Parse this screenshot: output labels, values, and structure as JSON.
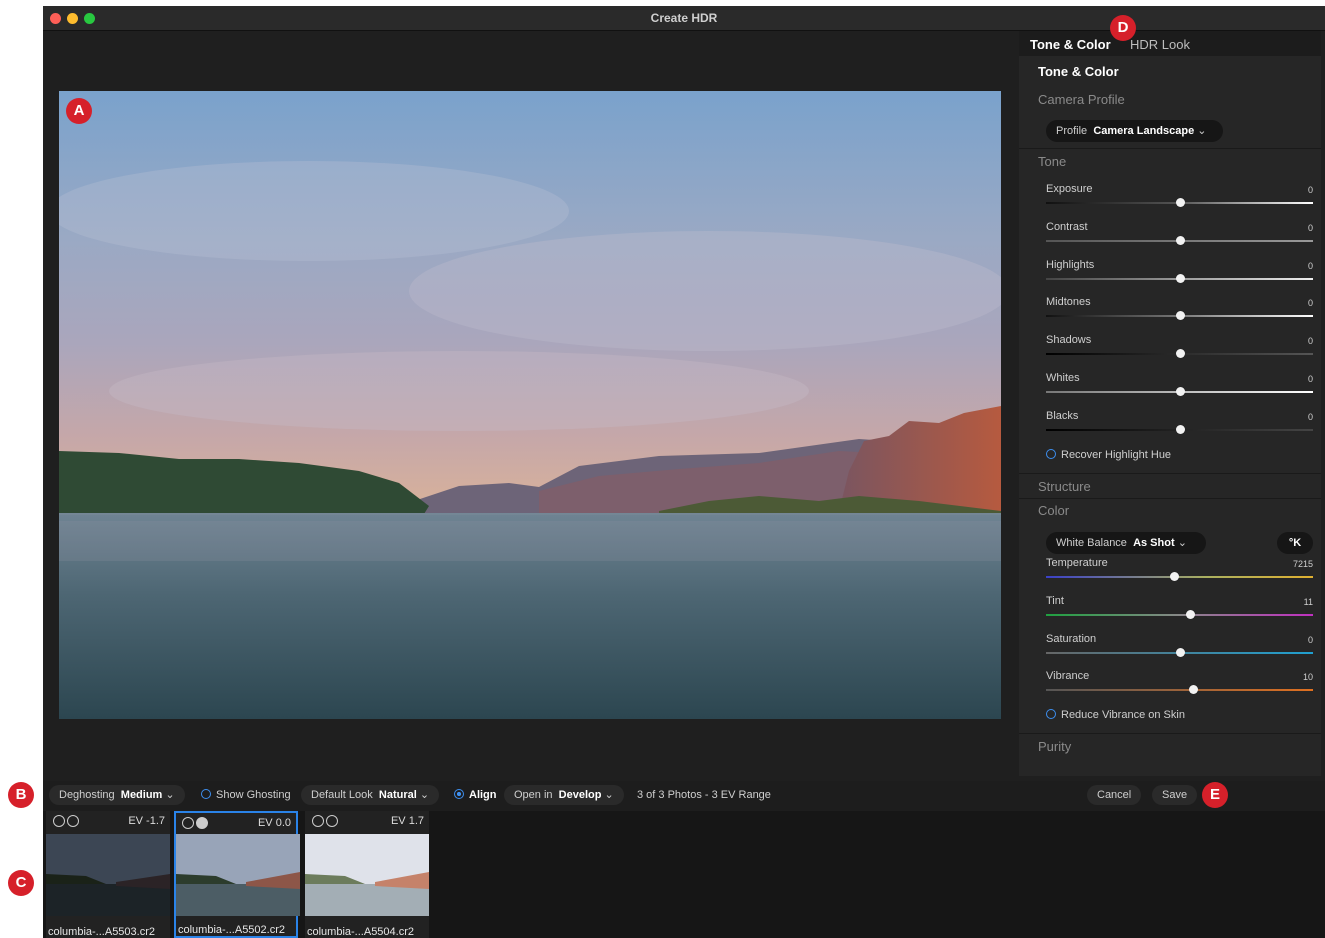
{
  "window": {
    "title": "Create HDR"
  },
  "markers": {
    "a": "A",
    "b": "B",
    "c": "C",
    "d": "D",
    "e": "E"
  },
  "panel": {
    "tabs": [
      "Tone & Color",
      "HDR Look"
    ],
    "section_title": "Tone & Color",
    "camera_profile_label": "Camera Profile",
    "profile_label": "Profile",
    "profile_value": "Camera Landscape",
    "tone_label": "Tone",
    "tone_sliders": [
      {
        "label": "Exposure",
        "value": "0",
        "level": 0.5
      },
      {
        "label": "Contrast",
        "value": "0",
        "level": 0.5
      },
      {
        "label": "Highlights",
        "value": "0",
        "level": 0.5
      },
      {
        "label": "Midtones",
        "value": "0",
        "level": 0.5
      },
      {
        "label": "Shadows",
        "value": "0",
        "level": 0.5
      },
      {
        "label": "Whites",
        "value": "0",
        "level": 0.5
      },
      {
        "label": "Blacks",
        "value": "0",
        "level": 0.5
      }
    ],
    "recover_highlight_hue": "Recover Highlight Hue",
    "structure_label": "Structure",
    "color_label": "Color",
    "white_balance_label": "White Balance",
    "white_balance_value": "As Shot",
    "kelvin_button": "°K",
    "color_sliders": [
      {
        "label": "Temperature",
        "value": "7215",
        "level": 0.48
      },
      {
        "label": "Tint",
        "value": "11",
        "level": 0.54
      },
      {
        "label": "Saturation",
        "value": "0",
        "level": 0.5
      },
      {
        "label": "Vibrance",
        "value": "10",
        "level": 0.55
      }
    ],
    "reduce_vibrance": "Reduce Vibrance on Skin",
    "purity_label": "Purity"
  },
  "bottom_bar": {
    "deghosting_label": "Deghosting",
    "deghosting_value": "Medium",
    "show_ghosting": "Show Ghosting",
    "default_look_label": "Default Look",
    "default_look_value": "Natural",
    "align": "Align",
    "open_in_label": "Open in",
    "open_in_value": "Develop",
    "summary": "3 of 3 Photos - 3 EV Range",
    "cancel": "Cancel",
    "save": "Save"
  },
  "filmstrip": [
    {
      "ev": "EV -1.7",
      "name": "columbia-...A5503.cr2",
      "selected": false
    },
    {
      "ev": "EV 0.0",
      "name": "columbia-...A5502.cr2",
      "selected": true
    },
    {
      "ev": "EV 1.7",
      "name": "columbia-...A5504.cr2",
      "selected": false
    }
  ],
  "colors": {
    "accent": "#2a83e8",
    "marker": "#d6202a"
  }
}
